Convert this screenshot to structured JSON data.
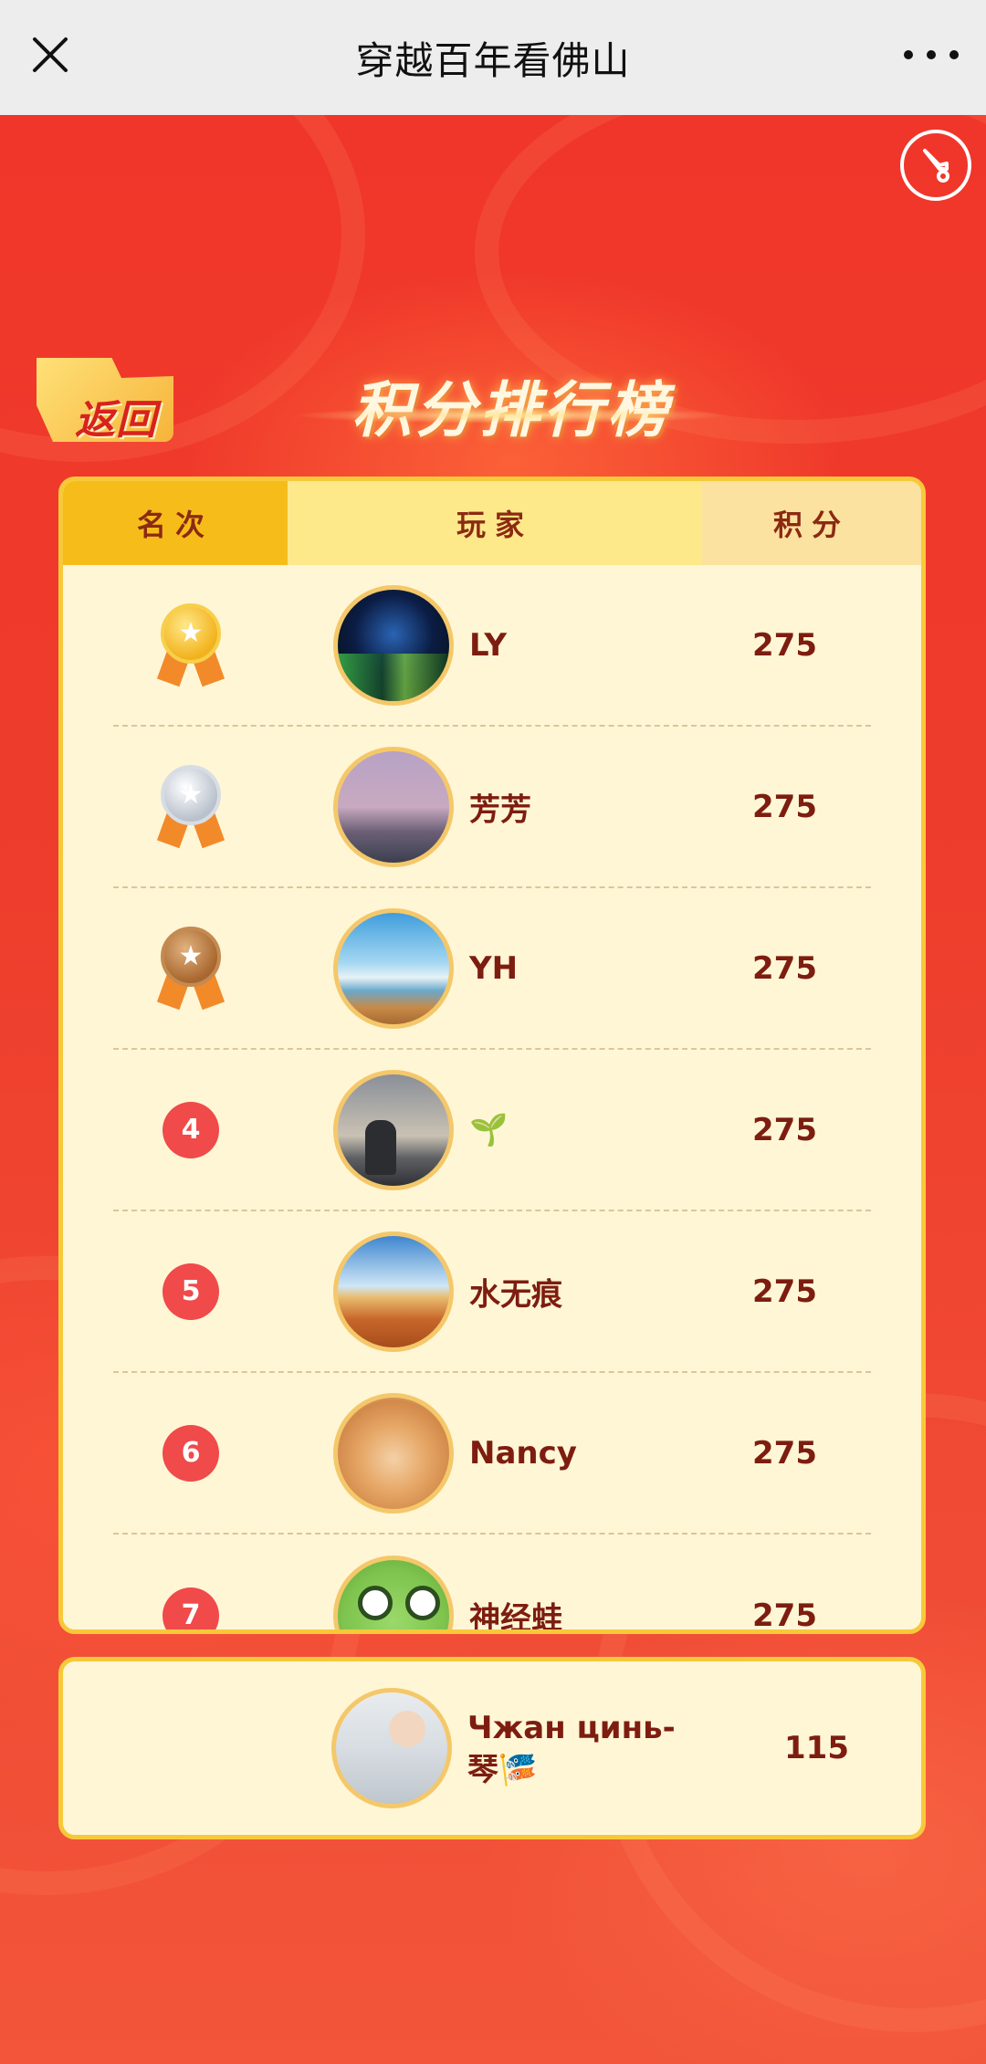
{
  "topbar": {
    "title": "穿越百年看佛山",
    "close_icon": "close-icon",
    "more_icon": "more-icon"
  },
  "page": {
    "back_label": "返回",
    "heading": "积分排行榜",
    "music_icon": "music-toggle-icon"
  },
  "table": {
    "headers": {
      "rank": "名次",
      "player": "玩家",
      "score": "积分"
    },
    "rows": [
      {
        "rank": "1",
        "medal": "gold",
        "avatar": "av-ly",
        "name": "LY",
        "score": "275"
      },
      {
        "rank": "2",
        "medal": "silver",
        "avatar": "av-ff",
        "name": "芳芳",
        "score": "275"
      },
      {
        "rank": "3",
        "medal": "bronze",
        "avatar": "av-yh",
        "name": "YH",
        "score": "275"
      },
      {
        "rank": "4",
        "medal": "",
        "avatar": "av-4",
        "name": "🌱",
        "score": "275"
      },
      {
        "rank": "5",
        "medal": "",
        "avatar": "av-5",
        "name": "水无痕",
        "score": "275"
      },
      {
        "rank": "6",
        "medal": "",
        "avatar": "av-6",
        "name": "Nancy",
        "score": "275"
      },
      {
        "rank": "7",
        "medal": "",
        "avatar": "av-7",
        "name": "神经蛙",
        "score": "275"
      }
    ]
  },
  "self": {
    "name": "Чжан цинь-琴🎏",
    "score": "115"
  },
  "colors": {
    "background_red": "#ef3b2c",
    "card_bg": "#fff6d6",
    "card_border": "#f7c93a",
    "text_brown": "#7d1d10",
    "rank_badge": "#f04a4a"
  }
}
